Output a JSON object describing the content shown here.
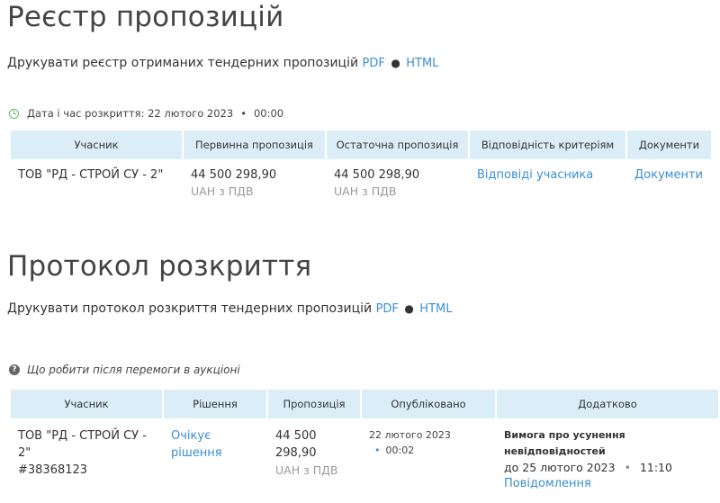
{
  "registry": {
    "title": "Реєстр пропозицій",
    "print_label": "Друкувати реєстр отриманих тендерних пропозицій",
    "pdf": "PDF",
    "sep": "●",
    "html": "HTML",
    "opening_label": "Дата і час розкриття: 22 лютого 2023",
    "opening_sep": "•",
    "opening_time": "00:00",
    "headers": [
      "Учасник",
      "Первинна пропозиція",
      "Остаточна пропозиція",
      "Відповідність критеріям",
      "Документи"
    ],
    "row": {
      "participant": "ТОВ \"РД - СТРОЙ СУ - 2\"",
      "initial_amount": "44 500 298,90",
      "initial_currency": "UAH з ПДВ",
      "final_amount": "44 500 298,90",
      "final_currency": "UAH з ПДВ",
      "criteria_link": "Відповіді учасника",
      "documents_link": "Документи"
    }
  },
  "protocol": {
    "title": "Протокол розкриття",
    "print_label": "Друкувати протокол розкриття тендерних пропозицій",
    "pdf": "PDF",
    "sep": "●",
    "html": "HTML",
    "help_text": "Що робити після перемоги в аукціоні",
    "headers": [
      "Учасник",
      "Рішення",
      "Пропозиція",
      "Опубліковано",
      "Додатково"
    ],
    "row": {
      "participant_line1": "ТОВ \"РД - СТРОЙ СУ -",
      "participant_line2": "2\"",
      "participant_id": "#38368123",
      "decision_line1": "Очікує",
      "decision_line2": "рішення",
      "amount_line1": "44 500",
      "amount_line2": "298,90",
      "currency": "UAH з ПДВ",
      "published_date": "22 лютого 2023",
      "published_sep": "•",
      "published_time": "00:02",
      "extra_title_line1": "Вимога про усунення",
      "extra_title_line2": "невідповідностей",
      "extra_deadline": "до 25 лютого 2023",
      "extra_sep": "•",
      "extra_time": "11:10",
      "extra_link": "Повідомлення"
    }
  },
  "colors": {
    "accent": "#3a8fd1",
    "header_bg": "#dbeef8",
    "clock": "#5cb85c"
  }
}
